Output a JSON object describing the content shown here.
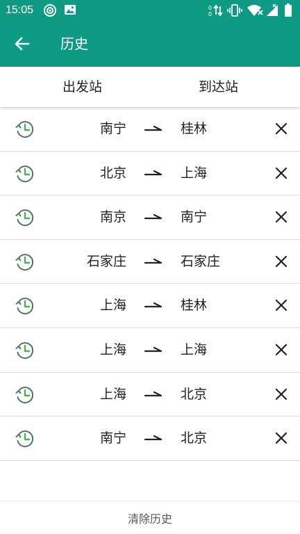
{
  "status_bar": {
    "time": "15:05",
    "icons": [
      "sync-icon",
      "image-icon",
      "data-arrows-icon",
      "vibrate-icon",
      "wifi-icon",
      "signal-icon",
      "battery-icon"
    ]
  },
  "app_bar": {
    "title": "历史",
    "back_icon": "arrow-back-icon"
  },
  "header": {
    "from_label": "出发站",
    "to_label": "到达站"
  },
  "history": [
    {
      "from": "南宁",
      "to": "桂林"
    },
    {
      "from": "北京",
      "to": "上海"
    },
    {
      "from": "南京",
      "to": "南宁"
    },
    {
      "from": "石家庄",
      "to": "石家庄"
    },
    {
      "from": "上海",
      "to": "桂林"
    },
    {
      "from": "上海",
      "to": "上海"
    },
    {
      "from": "上海",
      "to": "北京"
    },
    {
      "from": "南宁",
      "to": "北京"
    }
  ],
  "footer": {
    "clear_label": "清除历史"
  },
  "colors": {
    "primary": "#0f9a84",
    "clock_hand": "#4caf50",
    "clock_ring": "#546e7a"
  }
}
